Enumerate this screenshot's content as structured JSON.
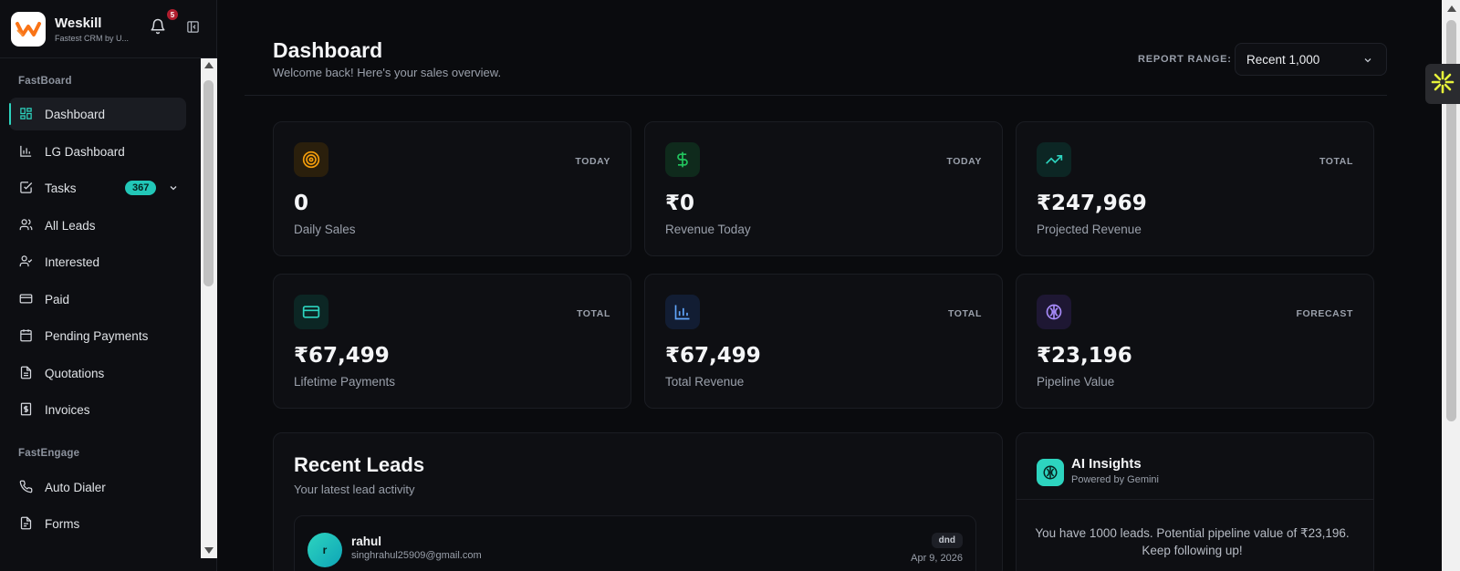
{
  "brand": {
    "name": "Weskill",
    "subtitle": "Fastest CRM by U...",
    "notifications": "5"
  },
  "sidebar": {
    "sections": [
      {
        "label": "FastBoard"
      },
      {
        "label": "FastEngage"
      }
    ],
    "items": [
      {
        "label": "Dashboard"
      },
      {
        "label": "LG Dashboard"
      },
      {
        "label": "Tasks",
        "badge": "367"
      },
      {
        "label": "All Leads"
      },
      {
        "label": "Interested"
      },
      {
        "label": "Paid"
      },
      {
        "label": "Pending Payments"
      },
      {
        "label": "Quotations"
      },
      {
        "label": "Invoices"
      },
      {
        "label": "Auto Dialer"
      },
      {
        "label": "Forms"
      }
    ]
  },
  "header": {
    "title": "Dashboard",
    "subtitle": "Welcome back! Here's your sales overview.",
    "report_range_label": "REPORT RANGE:",
    "report_range_value": "Recent 1,000"
  },
  "stats": [
    {
      "period": "TODAY",
      "value": "0",
      "label": "Daily Sales",
      "icon": "target-icon",
      "color": "#f59e0b"
    },
    {
      "period": "TODAY",
      "value": "₹0",
      "label": "Revenue Today",
      "icon": "dollar-icon",
      "color": "#22c55e"
    },
    {
      "period": "TOTAL",
      "value": "₹247,969",
      "label": "Projected Revenue",
      "icon": "trending-up-icon",
      "color": "#2dd4bf"
    },
    {
      "period": "TOTAL",
      "value": "₹67,499",
      "label": "Lifetime Payments",
      "icon": "credit-card-icon",
      "color": "#2dd4bf"
    },
    {
      "period": "TOTAL",
      "value": "₹67,499",
      "label": "Total Revenue",
      "icon": "bar-chart-icon",
      "color": "#60a5fa"
    },
    {
      "period": "FORECAST",
      "value": "₹23,196",
      "label": "Pipeline Value",
      "icon": "brain-icon",
      "color": "#a78bfa"
    }
  ],
  "recent_leads": {
    "title": "Recent Leads",
    "subtitle": "Your latest lead activity",
    "rows": [
      {
        "initial": "r",
        "name": "rahul",
        "email": "singhrahul25909@gmail.com",
        "tag": "dnd",
        "date": "Apr 9, 2026"
      }
    ]
  },
  "ai_insights": {
    "title": "AI Insights",
    "subtitle": "Powered by Gemini",
    "text": "You have 1000 leads. Potential pipeline value of ₹23,196. Keep following up!"
  },
  "colors": {
    "accent": "#2dd4bf",
    "background": "#0a0b0e",
    "card": "#0e0f13"
  }
}
